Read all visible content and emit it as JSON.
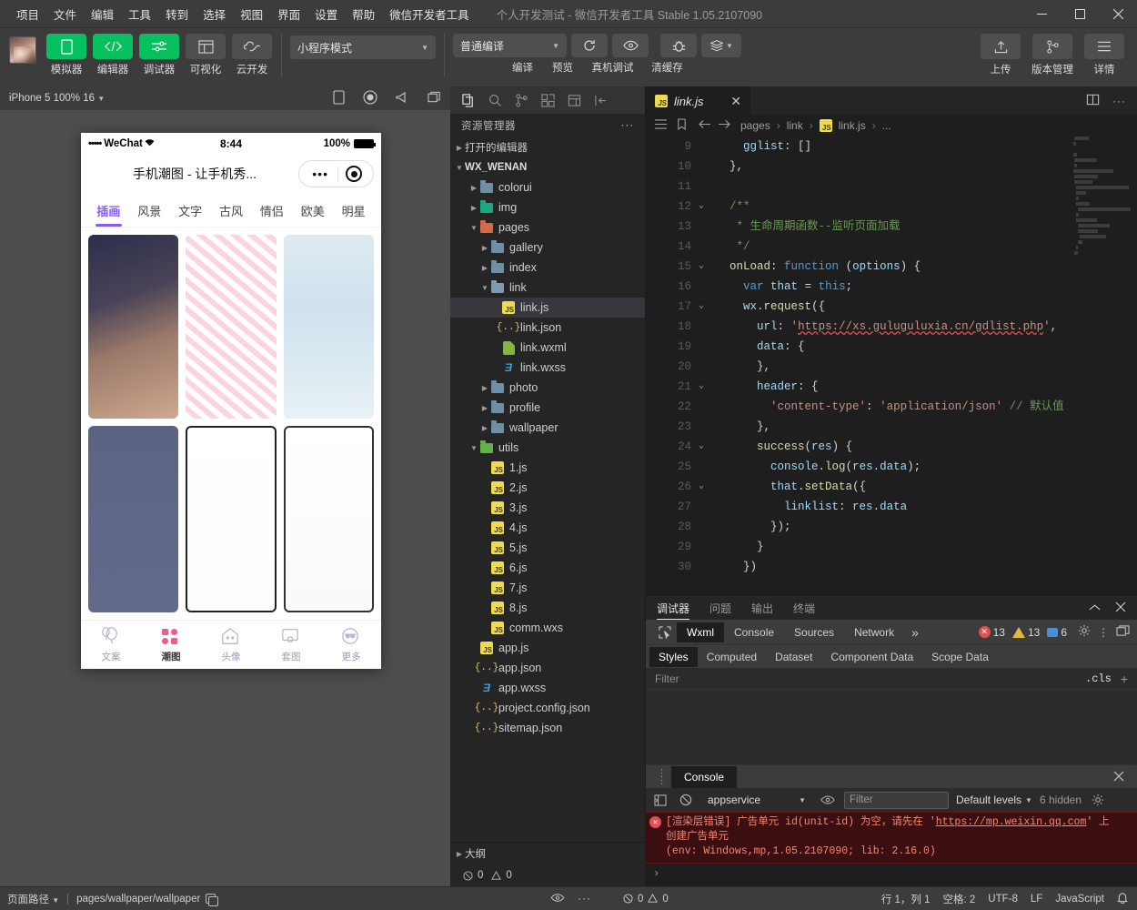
{
  "window": {
    "menus": [
      "项目",
      "文件",
      "编辑",
      "工具",
      "转到",
      "选择",
      "视图",
      "界面",
      "设置",
      "帮助",
      "微信开发者工具"
    ],
    "title": "个人开发测试 - 微信开发者工具 Stable 1.05.2107090",
    "controls": {
      "minimize": "—",
      "maximize": "▢",
      "close": "✕"
    }
  },
  "toolbar": {
    "buttons": [
      {
        "label": "模拟器",
        "icon": "phone-icon",
        "style": "green"
      },
      {
        "label": "编辑器",
        "icon": "code-icon",
        "style": "green"
      },
      {
        "label": "调试器",
        "icon": "debug-icon",
        "style": "green"
      },
      {
        "label": "可视化",
        "icon": "layout-icon",
        "style": "grey"
      },
      {
        "label": "云开发",
        "icon": "cloud-icon",
        "style": "grey"
      }
    ],
    "mode_select": "小程序模式",
    "compile_select": "普通编译",
    "action_labels": [
      "编译",
      "预览",
      "真机调试",
      "清缓存"
    ],
    "right_buttons": [
      {
        "label": "上传",
        "icon": "upload-icon"
      },
      {
        "label": "版本管理",
        "icon": "branch-icon"
      },
      {
        "label": "详情",
        "icon": "menu-icon"
      }
    ]
  },
  "simulator": {
    "device_label": "iPhone 5 100% 16",
    "toolbar_icons": [
      "device-rotate-icon",
      "record-icon",
      "volume-icon",
      "window-icon"
    ],
    "status_bar": {
      "carrier_dots": "•••••",
      "carrier": "WeChat",
      "wifi": "⌃",
      "time": "8:44",
      "battery_pct": "100%"
    },
    "nav_title": "手机潮图 - 让手机秀...",
    "capsule": {
      "dots": "•••",
      "target": "◉"
    },
    "category_tabs": [
      "插画",
      "风景",
      "文字",
      "古风",
      "情侣",
      "欧美",
      "明星"
    ],
    "active_category": "插画",
    "tab_bar": [
      {
        "label": "文案",
        "icon": "balloon-icon"
      },
      {
        "label": "潮图",
        "icon": "grid-icon"
      },
      {
        "label": "头像",
        "icon": "ghost-icon"
      },
      {
        "label": "套图",
        "icon": "frame-icon"
      },
      {
        "label": "更多",
        "icon": "sunglasses-icon"
      }
    ],
    "active_tab": "潮图"
  },
  "explorer": {
    "activity_icons": [
      "files-icon",
      "search-icon",
      "source-control-icon",
      "extensions-icon",
      "preview-icon",
      "collapse-icon"
    ],
    "title": "资源管理器",
    "more": "···",
    "sections": [
      {
        "label": "打开的编辑器",
        "expanded": false,
        "depth": 0,
        "type": "section"
      },
      {
        "label": "WX_WENAN",
        "expanded": true,
        "depth": 0,
        "type": "root"
      }
    ],
    "tree": [
      {
        "label": "colorui",
        "depth": 1,
        "type": "folder",
        "expanded": false
      },
      {
        "label": "img",
        "depth": 1,
        "type": "folder-teal",
        "expanded": false
      },
      {
        "label": "pages",
        "depth": 1,
        "type": "folder-red",
        "expanded": true
      },
      {
        "label": "gallery",
        "depth": 2,
        "type": "folder",
        "expanded": false
      },
      {
        "label": "index",
        "depth": 2,
        "type": "folder",
        "expanded": false
      },
      {
        "label": "link",
        "depth": 2,
        "type": "folder-open",
        "expanded": true
      },
      {
        "label": "link.js",
        "depth": 3,
        "type": "js",
        "selected": true
      },
      {
        "label": "link.json",
        "depth": 3,
        "type": "json"
      },
      {
        "label": "link.wxml",
        "depth": 3,
        "type": "wxml"
      },
      {
        "label": "link.wxss",
        "depth": 3,
        "type": "wxss"
      },
      {
        "label": "photo",
        "depth": 2,
        "type": "folder",
        "expanded": false
      },
      {
        "label": "profile",
        "depth": 2,
        "type": "folder",
        "expanded": false
      },
      {
        "label": "wallpaper",
        "depth": 2,
        "type": "folder",
        "expanded": false
      },
      {
        "label": "utils",
        "depth": 1,
        "type": "folder-green",
        "expanded": true
      },
      {
        "label": "1.js",
        "depth": 2,
        "type": "js"
      },
      {
        "label": "2.js",
        "depth": 2,
        "type": "js"
      },
      {
        "label": "3.js",
        "depth": 2,
        "type": "js"
      },
      {
        "label": "4.js",
        "depth": 2,
        "type": "js"
      },
      {
        "label": "5.js",
        "depth": 2,
        "type": "js"
      },
      {
        "label": "6.js",
        "depth": 2,
        "type": "js"
      },
      {
        "label": "7.js",
        "depth": 2,
        "type": "js"
      },
      {
        "label": "8.js",
        "depth": 2,
        "type": "js"
      },
      {
        "label": "comm.wxs",
        "depth": 2,
        "type": "js"
      },
      {
        "label": "app.js",
        "depth": 1,
        "type": "js"
      },
      {
        "label": "app.json",
        "depth": 1,
        "type": "json"
      },
      {
        "label": "app.wxss",
        "depth": 1,
        "type": "wxss"
      },
      {
        "label": "project.config.json",
        "depth": 1,
        "type": "json"
      },
      {
        "label": "sitemap.json",
        "depth": 1,
        "type": "json"
      }
    ],
    "outline": {
      "label": "大纲",
      "expanded": false
    },
    "problems": {
      "errors": "0",
      "warnings": "0"
    }
  },
  "editor": {
    "tab": {
      "label": "link.js",
      "icon": "js-icon",
      "close": "✕"
    },
    "tab_tools": [
      "split-editor-icon",
      "more-actions-icon"
    ],
    "breadcrumb": [
      "pages",
      "link",
      "link.js",
      "..."
    ],
    "gutter_icons": [
      "outline-icon",
      "bookmark-icon",
      "back-icon",
      "forward-icon"
    ],
    "first_line": 9,
    "lines": [
      {
        "n": 9,
        "text": "      gglist: []"
      },
      {
        "n": 10,
        "text": "    },"
      },
      {
        "n": 11,
        "text": ""
      },
      {
        "n": 12,
        "text": "    /**",
        "fold": true
      },
      {
        "n": 13,
        "text": "     * 生命周期函数--监听页面加载"
      },
      {
        "n": 14,
        "text": "     */"
      },
      {
        "n": 15,
        "text": "    onLoad: function (options) {",
        "fold": true
      },
      {
        "n": 16,
        "text": "      var that = this;"
      },
      {
        "n": 17,
        "text": "      wx.request({",
        "fold": true
      },
      {
        "n": 18,
        "text": "        url: 'https://xs.guluguluxia.cn/gdlist.php',"
      },
      {
        "n": 19,
        "text": "        data: {"
      },
      {
        "n": 20,
        "text": "        },"
      },
      {
        "n": 21,
        "text": "        header: {",
        "fold": true
      },
      {
        "n": 22,
        "text": "          'content-type': 'application/json' // 默认值"
      },
      {
        "n": 23,
        "text": "        },"
      },
      {
        "n": 24,
        "text": "        success(res) {",
        "fold": true
      },
      {
        "n": 25,
        "text": "          console.log(res.data);"
      },
      {
        "n": 26,
        "text": "          that.setData({",
        "fold": true
      },
      {
        "n": 27,
        "text": "            linklist: res.data"
      },
      {
        "n": 28,
        "text": "          });"
      },
      {
        "n": 29,
        "text": "        }"
      },
      {
        "n": 30,
        "text": "      })"
      }
    ],
    "url_string": "https://xs.guluguluxia.cn/gdlist.php"
  },
  "debugger": {
    "panel_tabs": [
      "调试器",
      "问题",
      "输出",
      "终端"
    ],
    "active_panel_tab": "调试器",
    "panel_actions": [
      "collapse-icon",
      "close-icon"
    ],
    "devtools_tabs": [
      "Wxml",
      "Console",
      "Sources",
      "Network"
    ],
    "active_devtools_tab": "Wxml",
    "more_tabs": "»",
    "counts": {
      "errors": "13",
      "warnings": "13",
      "info": "6"
    },
    "right_icons": [
      "settings-gear-icon",
      "kebab-icon",
      "dock-icon"
    ],
    "style_tabs": [
      "Styles",
      "Computed",
      "Dataset",
      "Component Data",
      "Scope Data"
    ],
    "active_style_tab": "Styles",
    "filter_placeholder": "Filter",
    "cls_label": ".cls",
    "add_rule": "+",
    "console": {
      "title": "Console",
      "context": "appservice",
      "filter_placeholder": "Filter",
      "levels": "Default levels",
      "hidden": "6 hidden",
      "tool_icons": [
        "sidebar-icon",
        "clear-console-icon",
        "eye-icon",
        "settings-gear-icon"
      ],
      "error": {
        "line1_pre": "[渲染层错误] 广告单元 id(unit-id) 为空，请先在 '",
        "link": "https://mp.weixin.qq.com",
        "line1_post": "' 上",
        "line2": "创建广告单元",
        "line3": "(env: Windows,mp,1.05.2107090; lib: 2.16.0)"
      },
      "prompt": "›"
    }
  },
  "statusbar": {
    "page_path_label": "页面路径",
    "page_path": "pages/wallpaper/wallpaper",
    "left_icons": [
      "eye-icon",
      "more-icon"
    ],
    "problems": {
      "errors": "0",
      "warnings": "0"
    },
    "cursor": "行 1，列 1",
    "spaces": "空格: 2",
    "encoding": "UTF-8",
    "eol": "LF",
    "language": "JavaScript",
    "bell": "bell-icon"
  },
  "colors": {
    "accent_green": "#07c160",
    "accent_purple": "#8a5cf6",
    "error_red": "#e05252",
    "warning_yellow": "#e2b93d",
    "info_blue": "#4a8fd4"
  }
}
